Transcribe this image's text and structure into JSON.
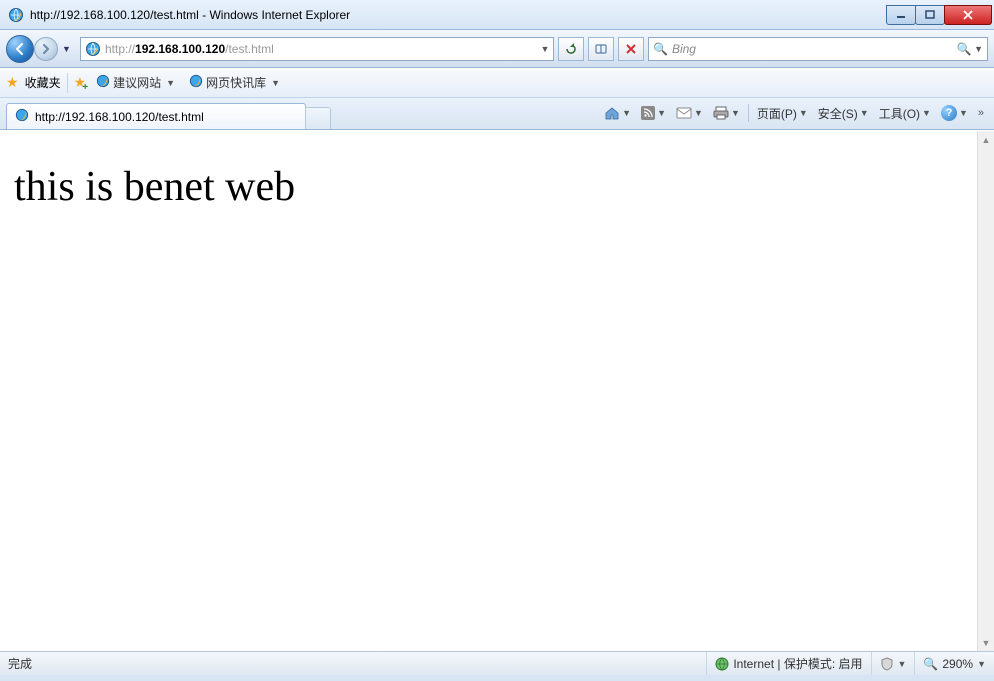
{
  "titlebar": {
    "title": "http://192.168.100.120/test.html - Windows Internet Explorer"
  },
  "navbar": {
    "url_prefix": "http://",
    "url_host": "192.168.100.120",
    "url_path": "/test.html",
    "search_placeholder": "Bing"
  },
  "favbar": {
    "label": "收藏夹",
    "suggested": "建议网站",
    "slice": "网页快讯库"
  },
  "tab": {
    "title": "http://192.168.100.120/test.html"
  },
  "cmdbar": {
    "page": "页面(P)",
    "safety": "安全(S)",
    "tools": "工具(O)"
  },
  "page": {
    "body": "this is benet web"
  },
  "status": {
    "done": "完成",
    "zone": "Internet | 保护模式: 启用",
    "zoom": "290%"
  }
}
